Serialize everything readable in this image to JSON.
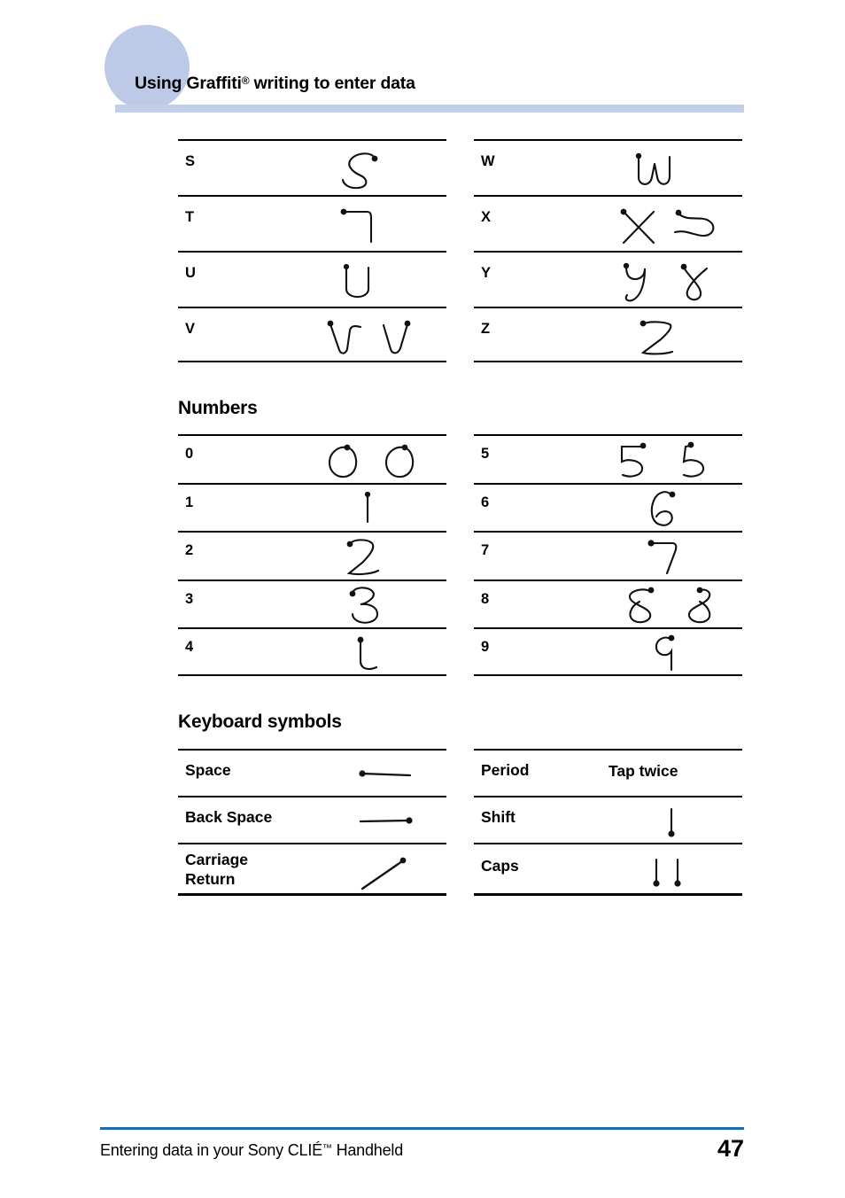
{
  "header": {
    "title_main": "Using Graffiti",
    "title_sup": "®",
    "title_rest": " writing to enter data"
  },
  "sections": {
    "numbers_heading": "Numbers",
    "keyboard_heading": "Keyboard symbols"
  },
  "letters": {
    "left": [
      {
        "label": "S",
        "glyph": "stroke-s"
      },
      {
        "label": "T",
        "glyph": "stroke-t"
      },
      {
        "label": "U",
        "glyph": "stroke-u"
      },
      {
        "label": "V",
        "glyph": "stroke-v"
      }
    ],
    "right": [
      {
        "label": "W",
        "glyph": "stroke-w"
      },
      {
        "label": "X",
        "glyph": "stroke-x"
      },
      {
        "label": "Y",
        "glyph": "stroke-y"
      },
      {
        "label": "Z",
        "glyph": "stroke-z"
      }
    ]
  },
  "numbers": {
    "left": [
      {
        "label": "0",
        "glyph": "stroke-0"
      },
      {
        "label": "1",
        "glyph": "stroke-1"
      },
      {
        "label": "2",
        "glyph": "stroke-2"
      },
      {
        "label": "3",
        "glyph": "stroke-3"
      },
      {
        "label": "4",
        "glyph": "stroke-4"
      }
    ],
    "right": [
      {
        "label": "5",
        "glyph": "stroke-5"
      },
      {
        "label": "6",
        "glyph": "stroke-6"
      },
      {
        "label": "7",
        "glyph": "stroke-7"
      },
      {
        "label": "8",
        "glyph": "stroke-8"
      },
      {
        "label": "9",
        "glyph": "stroke-9"
      }
    ]
  },
  "keyboard": {
    "left": [
      {
        "label": "Space",
        "glyph": "stroke-space"
      },
      {
        "label": "Back Space",
        "glyph": "stroke-back-space"
      },
      {
        "label": "Carriage\nReturn",
        "label_line1": "Carriage",
        "label_line2": "Return",
        "glyph": "stroke-carriage-return"
      }
    ],
    "right": [
      {
        "label": "Period",
        "glyph": "text",
        "glyph_text": "Tap twice"
      },
      {
        "label": "Shift",
        "glyph": "stroke-shift"
      },
      {
        "label": "Caps",
        "glyph": "stroke-caps"
      }
    ]
  },
  "footer": {
    "text_main": "Entering data in your Sony CLIÉ",
    "text_sup": "™",
    "text_rest": " Handheld",
    "page_number": "47"
  },
  "colors": {
    "deco_circle": "#bdcae7",
    "header_rule": "#c3cfe9",
    "footer_rule": "#1d6cac",
    "ink": "#000000"
  }
}
